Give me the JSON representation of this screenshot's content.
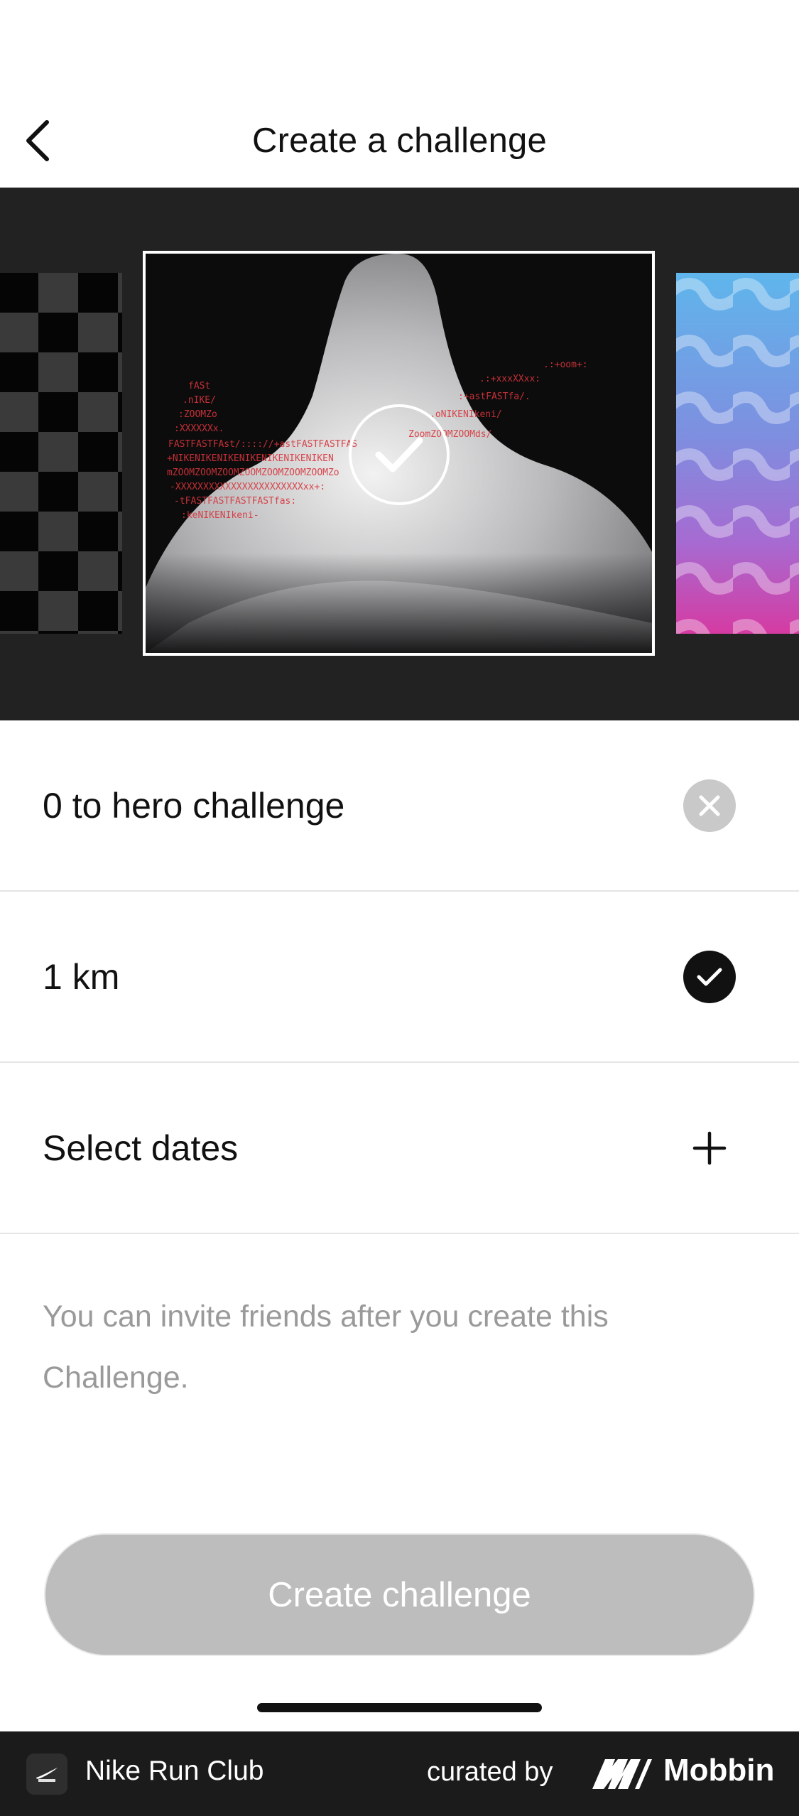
{
  "header": {
    "title": "Create a challenge",
    "back_icon": "chevron-left-icon"
  },
  "carousel": {
    "items": [
      {
        "name": "checkered-pattern",
        "selected": false
      },
      {
        "name": "mountain-fast-artwork",
        "selected": true
      },
      {
        "name": "wave-gradient-pattern",
        "selected": false
      }
    ],
    "selected_icon": "checkmark-icon"
  },
  "form": {
    "name_value": "0 to hero challenge",
    "name_action_icon": "clear-icon",
    "distance_value": "1 km",
    "distance_action_icon": "checkmark-icon",
    "dates_label": "Select dates",
    "dates_action_icon": "plus-icon",
    "info_text": "You can invite friends after you create this Challenge."
  },
  "actions": {
    "create_label": "Create challenge",
    "create_enabled": false
  },
  "footer": {
    "app_name": "Nike Run Club",
    "curated_label": "curated by",
    "brand": "Mobbin"
  },
  "colors": {
    "carousel_bg": "#222223",
    "button_disabled": "#bdbdbd",
    "footer_bg": "#1b1b1b",
    "muted_text": "#9a9a9a"
  }
}
